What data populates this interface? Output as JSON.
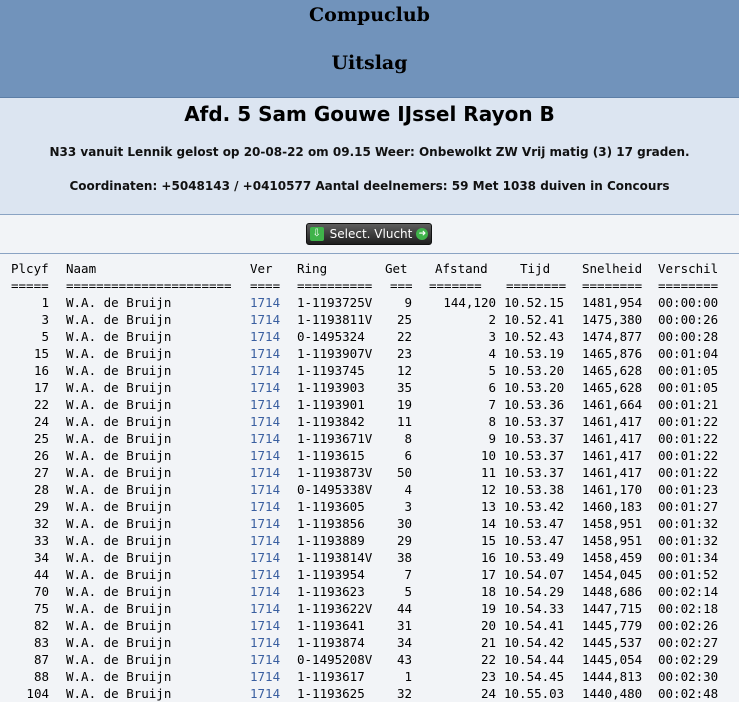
{
  "header": {
    "title": "Compuclub",
    "subtitle": "Uitslag"
  },
  "info": {
    "afd": "Afd. 5 Sam Gouwe IJssel Rayon B",
    "line1": "N33 vanuit Lennik gelost op 20-08-22 om 09.15 Weer: Onbewolkt ZW Vrij matig (3) 17 graden.",
    "line2": "Coordinaten: +5048143 / +0410577 Aantal deelnemers: 59 Met 1038 duiven in Concours"
  },
  "button": {
    "label": "Select. Vlucht"
  },
  "table": {
    "headers": {
      "plc": "Plcyf",
      "naam": "Naam",
      "ver": "Ver",
      "ring": "Ring",
      "get": "Get",
      "afs": "Afstand",
      "tijd": "Tijd",
      "snel": "Snelheid",
      "vers": "Verschil"
    },
    "separators": {
      "plc": "=====",
      "naam": "======================",
      "ver": "====",
      "ring": "==========",
      "get": "===",
      "afs": "=======",
      "tijd": "========",
      "snel": "========",
      "vers": "========"
    },
    "rows": [
      [
        "1",
        "W.A. de Bruijn",
        "1714",
        "1-1193725V",
        "9",
        "144,120",
        "10.52.15",
        "1481,954",
        "00:00:00"
      ],
      [
        "3",
        "W.A. de Bruijn",
        "1714",
        "1-1193811V",
        "25",
        "2",
        "10.52.41",
        "1475,380",
        "00:00:26"
      ],
      [
        "5",
        "W.A. de Bruijn",
        "1714",
        "0-1495324",
        "22",
        "3",
        "10.52.43",
        "1474,877",
        "00:00:28"
      ],
      [
        "15",
        "W.A. de Bruijn",
        "1714",
        "1-1193907V",
        "23",
        "4",
        "10.53.19",
        "1465,876",
        "00:01:04"
      ],
      [
        "16",
        "W.A. de Bruijn",
        "1714",
        "1-1193745",
        "12",
        "5",
        "10.53.20",
        "1465,628",
        "00:01:05"
      ],
      [
        "17",
        "W.A. de Bruijn",
        "1714",
        "1-1193903",
        "35",
        "6",
        "10.53.20",
        "1465,628",
        "00:01:05"
      ],
      [
        "22",
        "W.A. de Bruijn",
        "1714",
        "1-1193901",
        "19",
        "7",
        "10.53.36",
        "1461,664",
        "00:01:21"
      ],
      [
        "24",
        "W.A. de Bruijn",
        "1714",
        "1-1193842",
        "11",
        "8",
        "10.53.37",
        "1461,417",
        "00:01:22"
      ],
      [
        "25",
        "W.A. de Bruijn",
        "1714",
        "1-1193671V",
        "8",
        "9",
        "10.53.37",
        "1461,417",
        "00:01:22"
      ],
      [
        "26",
        "W.A. de Bruijn",
        "1714",
        "1-1193615",
        "6",
        "10",
        "10.53.37",
        "1461,417",
        "00:01:22"
      ],
      [
        "27",
        "W.A. de Bruijn",
        "1714",
        "1-1193873V",
        "50",
        "11",
        "10.53.37",
        "1461,417",
        "00:01:22"
      ],
      [
        "28",
        "W.A. de Bruijn",
        "1714",
        "0-1495338V",
        "4",
        "12",
        "10.53.38",
        "1461,170",
        "00:01:23"
      ],
      [
        "29",
        "W.A. de Bruijn",
        "1714",
        "1-1193605",
        "3",
        "13",
        "10.53.42",
        "1460,183",
        "00:01:27"
      ],
      [
        "32",
        "W.A. de Bruijn",
        "1714",
        "1-1193856",
        "30",
        "14",
        "10.53.47",
        "1458,951",
        "00:01:32"
      ],
      [
        "33",
        "W.A. de Bruijn",
        "1714",
        "1-1193889",
        "29",
        "15",
        "10.53.47",
        "1458,951",
        "00:01:32"
      ],
      [
        "34",
        "W.A. de Bruijn",
        "1714",
        "1-1193814V",
        "38",
        "16",
        "10.53.49",
        "1458,459",
        "00:01:34"
      ],
      [
        "44",
        "W.A. de Bruijn",
        "1714",
        "1-1193954",
        "7",
        "17",
        "10.54.07",
        "1454,045",
        "00:01:52"
      ],
      [
        "70",
        "W.A. de Bruijn",
        "1714",
        "1-1193623",
        "5",
        "18",
        "10.54.29",
        "1448,686",
        "00:02:14"
      ],
      [
        "75",
        "W.A. de Bruijn",
        "1714",
        "1-1193622V",
        "44",
        "19",
        "10.54.33",
        "1447,715",
        "00:02:18"
      ],
      [
        "82",
        "W.A. de Bruijn",
        "1714",
        "1-1193641",
        "31",
        "20",
        "10.54.41",
        "1445,779",
        "00:02:26"
      ],
      [
        "83",
        "W.A. de Bruijn",
        "1714",
        "1-1193874",
        "34",
        "21",
        "10.54.42",
        "1445,537",
        "00:02:27"
      ],
      [
        "87",
        "W.A. de Bruijn",
        "1714",
        "0-1495208V",
        "43",
        "22",
        "10.54.44",
        "1445,054",
        "00:02:29"
      ],
      [
        "88",
        "W.A. de Bruijn",
        "1714",
        "1-1193617",
        "1",
        "23",
        "10.54.45",
        "1444,813",
        "00:02:30"
      ],
      [
        "104",
        "W.A. de Bruijn",
        "1714",
        "1-1193625",
        "32",
        "24",
        "10.55.03",
        "1440,480",
        "00:02:48"
      ]
    ]
  }
}
